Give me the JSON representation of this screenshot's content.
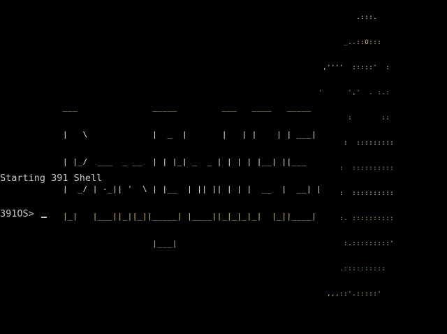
{
  "logo": {
    "rows": [
      "___               _____         ___   ____   _____ ",
      "|   \\             |  _  |       |   | |    | | ___|",
      "| |_/  ___  _ __  | | |_| _  _ | | | | |__| ||___  ",
      "|  _/ | -_|| '  \\ | |__  | || || | | |  __  |  __| |",
      "|_|   |___||_||_||_____| |____||_|_|_|_|  |_||____|",
      "                  |___|                            "
    ]
  },
  "penguin": {
    "rows": [
      "             .:::.",
      "          _..::O:::",
      "     ,''''  :::::'  :",
      "    '      ','  . :.:",
      "           :       ::",
      "          :  :::::::::",
      "         :  ::::::::::",
      "         :  ::::::::::",
      "         :. ::::::::::",
      "          :.:::::::::'",
      "         .::::::::::",
      "      ,,,::'.:::::'"
    ]
  },
  "terminal": {
    "boot_message": "Starting 391 Shell",
    "prompt": "391OS> ",
    "input_value": ""
  },
  "colors": {
    "background": "#000000",
    "text": "#c8c8c8",
    "art_accent_yellow": "#d9c870",
    "art_accent_cyan": "#7fc7c7"
  }
}
